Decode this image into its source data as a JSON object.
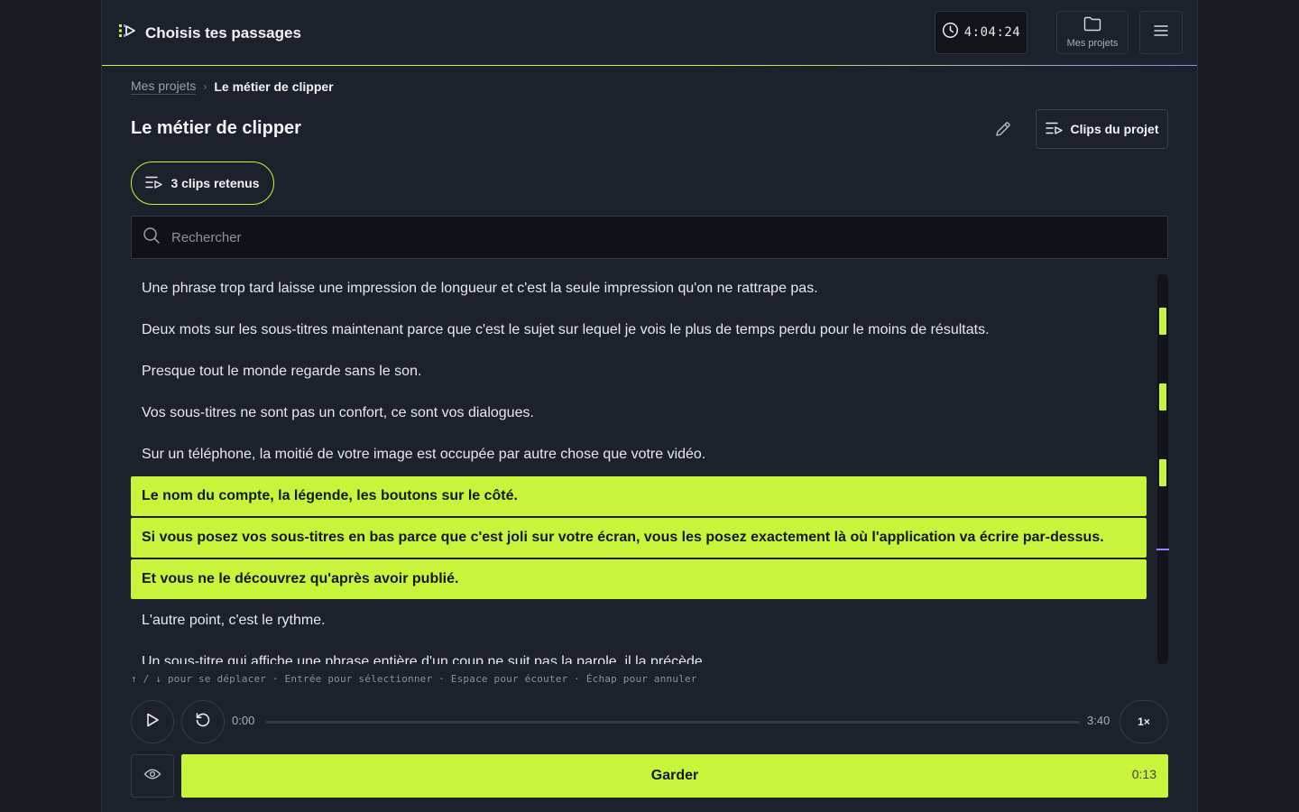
{
  "header": {
    "app_title": "Choisis tes passages",
    "timer": "4:04:24",
    "projects_label": "Mes projets",
    "icons": {
      "logo": "play-list-icon",
      "clock": "clock-icon",
      "folder": "folder-icon",
      "menu": "hamburger-icon"
    }
  },
  "breadcrumb": {
    "parent": "Mes projets",
    "separator": "›",
    "current": "Le métier de clipper"
  },
  "page": {
    "title": "Le métier de clipper",
    "clips_button": "Clips du projet",
    "retained_label": "3 clips retenus"
  },
  "search": {
    "placeholder": "Rechercher",
    "value": ""
  },
  "transcript": {
    "lines": [
      {
        "text": "Une phrase trop tard laisse une impression de longueur et c'est la seule impression qu'on ne rattrape pas.",
        "selected": false
      },
      {
        "text": "Deux mots sur les sous-titres maintenant parce que c'est le sujet sur lequel je vois le plus de temps perdu pour le moins de résultats.",
        "selected": false
      },
      {
        "text": "Presque tout le monde regarde sans le son.",
        "selected": false
      },
      {
        "text": "Vos sous-titres ne sont pas un confort, ce sont vos dialogues.",
        "selected": false
      },
      {
        "text": "Sur un téléphone, la moitié de votre image est occupée par autre chose que votre vidéo.",
        "selected": false
      },
      {
        "text": "Le nom du compte, la légende, les boutons sur le côté.",
        "selected": true
      },
      {
        "text": "Si vous posez vos sous-titres en bas parce que c'est joli sur votre écran, vous les posez exactement là où l'application va écrire par-dessus.",
        "selected": true
      },
      {
        "text": "Et vous ne le découvrez qu'après avoir publié.",
        "selected": true
      },
      {
        "text": "L'autre point, c'est le rythme.",
        "selected": false
      },
      {
        "text": "Un sous-titre qui affiche une phrase entière d'un coup ne suit pas la parole, il la précède.",
        "selected": false
      }
    ],
    "accent_color": "#c8f53c"
  },
  "hints": "↑ / ↓ pour se déplacer · Entrée pour sélectionner · Espace pour écouter · Échap pour annuler",
  "player": {
    "current_time": "0:00",
    "duration": "3:40",
    "progress": 0,
    "speed": "1×",
    "icons": {
      "play": "play-icon",
      "replay": "replay-icon",
      "eye": "eye-icon"
    }
  },
  "action": {
    "keep_label": "Garder",
    "clip_duration": "0:13"
  }
}
